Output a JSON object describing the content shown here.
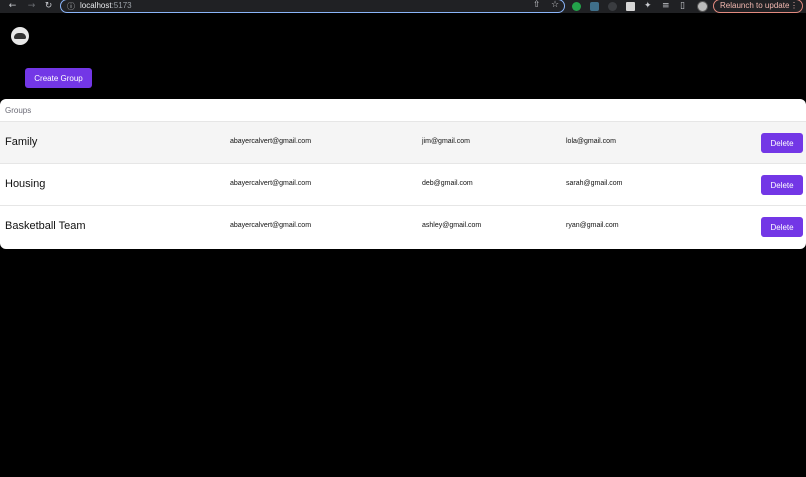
{
  "browser": {
    "url_host": "localhost",
    "url_port": ":5173",
    "relaunch_label": "Relaunch to update"
  },
  "app": {
    "create_button_label": "Create Group",
    "groups_header": "Groups",
    "delete_label": "Delete",
    "groups": [
      {
        "name": "Family",
        "members": [
          "abayercalvert@gmail.com",
          "jim@gmail.com",
          "lola@gmail.com"
        ]
      },
      {
        "name": "Housing",
        "members": [
          "abayercalvert@gmail.com",
          "deb@gmail.com",
          "sarah@gmail.com"
        ]
      },
      {
        "name": "Basketball Team",
        "members": [
          "abayercalvert@gmail.com",
          "ashley@gmail.com",
          "ryan@gmail.com"
        ]
      }
    ]
  },
  "colors": {
    "accent": "#7337e6",
    "background": "#000000"
  },
  "icons": [
    "back-icon",
    "forward-icon",
    "reload-icon",
    "site-info-icon",
    "share-icon",
    "star-icon",
    "extensions-icon",
    "reading-list-icon",
    "side-panel-icon"
  ]
}
